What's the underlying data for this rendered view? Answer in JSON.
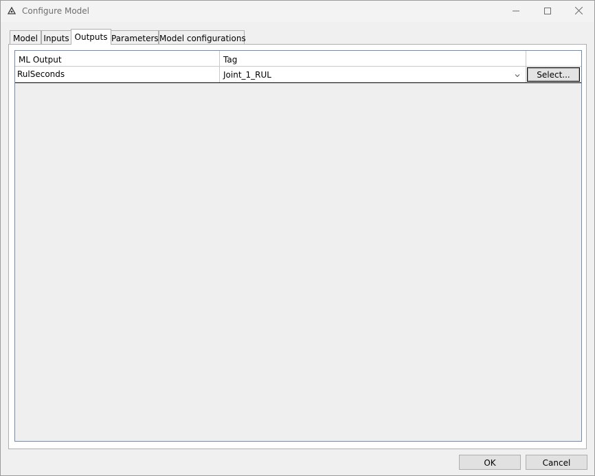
{
  "window": {
    "title": "Configure Model",
    "icon": "app-logo-icon",
    "controls": [
      "minimize-icon",
      "maximize-icon",
      "close-icon"
    ]
  },
  "tabs": [
    {
      "label": "Model",
      "active": false
    },
    {
      "label": "Inputs",
      "active": false
    },
    {
      "label": "Outputs",
      "active": true
    },
    {
      "label": "Parameters",
      "active": false
    },
    {
      "label": "Model configurations",
      "active": false
    }
  ],
  "grid": {
    "columns": [
      "ML Output",
      "Tag"
    ],
    "rows": [
      {
        "ml_output": "RulSeconds",
        "tag": "Joint_1_RUL",
        "button": "Select..."
      }
    ]
  },
  "footer": {
    "ok": "OK",
    "cancel": "Cancel"
  },
  "colors": {
    "grid_border": "#6e8ab0",
    "empty_area": "#efefef"
  }
}
